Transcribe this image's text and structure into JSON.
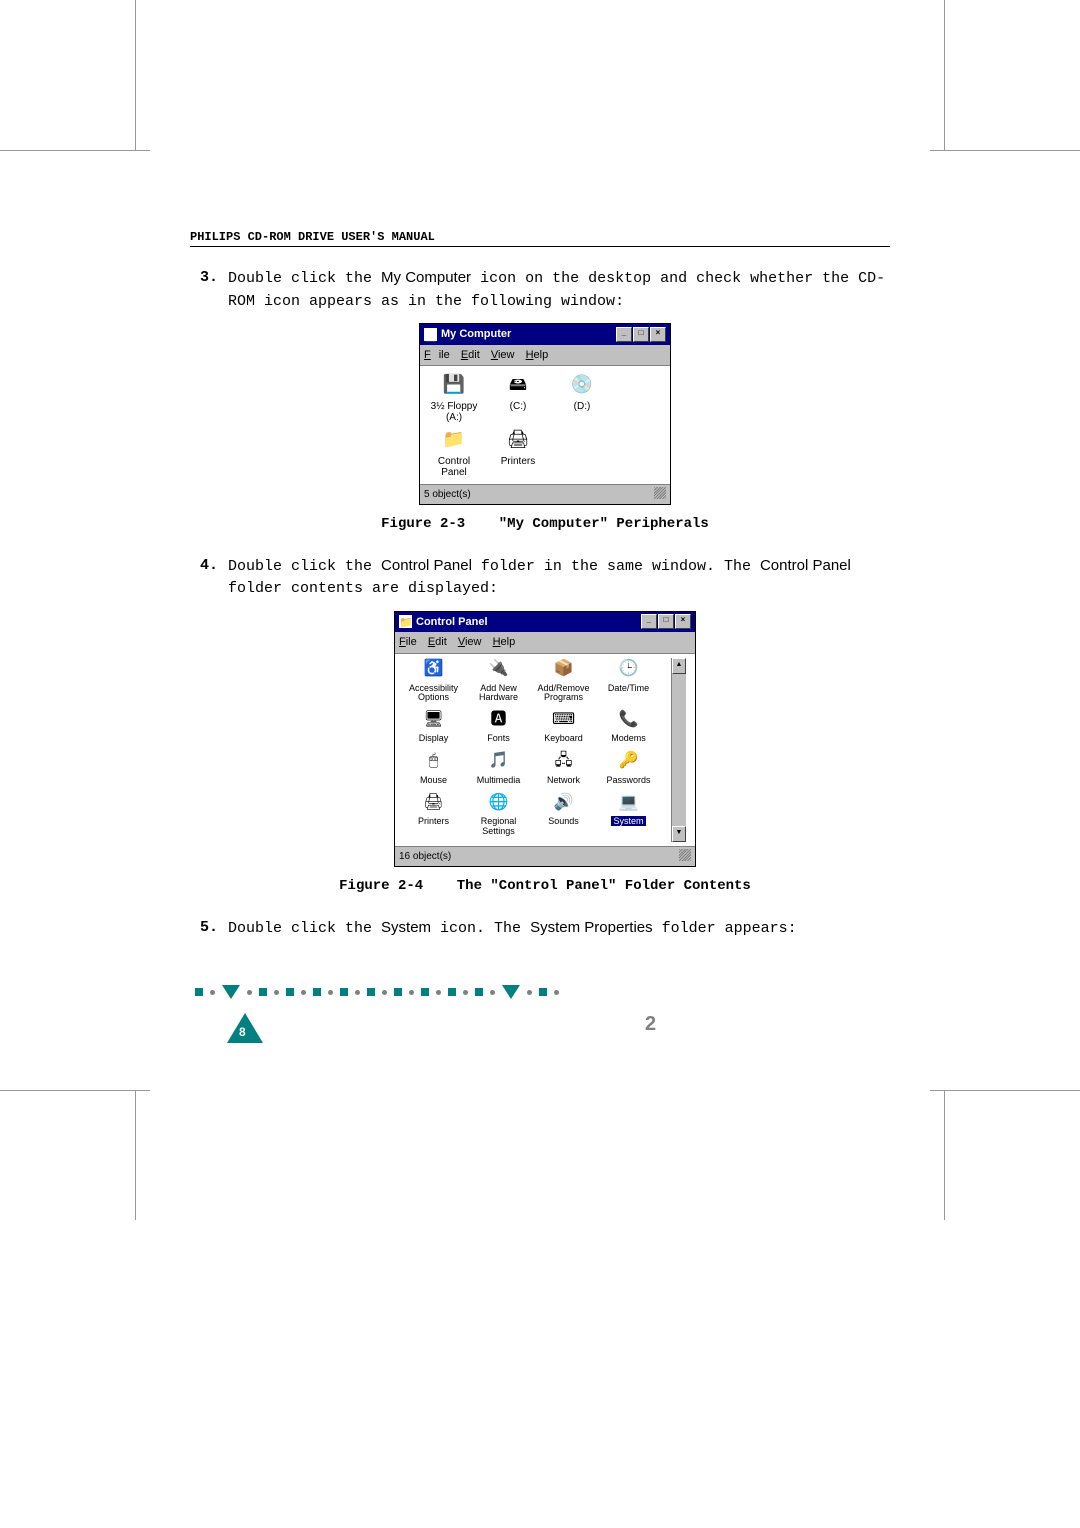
{
  "header": "PHILIPS CD-ROM DRIVE USER'S MANUAL",
  "step3": {
    "num": "3.",
    "pre": "Double click the ",
    "ui1": "My Computer",
    "mid": " icon on the desktop and check whether the CD-ROM icon appears as in the following window:"
  },
  "myComputer": {
    "title": "My Computer",
    "menus": [
      "File",
      "Edit",
      "View",
      "Help"
    ],
    "icons": [
      {
        "label": "3½ Floppy (A:)",
        "glyph": "💾"
      },
      {
        "label": "(C:)",
        "glyph": "🖴"
      },
      {
        "label": "(D:)",
        "glyph": "💿"
      },
      {
        "label": "Control Panel",
        "glyph": "📁"
      },
      {
        "label": "Printers",
        "glyph": "🖨"
      }
    ],
    "status": "5 object(s)"
  },
  "fig3": {
    "label": "Figure 2-3",
    "caption": "\"My Computer\" Peripherals"
  },
  "step4": {
    "num": "4.",
    "pre": "Double click the ",
    "ui1": "Control Panel",
    "mid": " folder in the same window.  The ",
    "ui2": "Control Panel",
    "post": " folder contents are displayed:"
  },
  "controlPanel": {
    "title": "Control Panel",
    "menus": [
      "File",
      "Edit",
      "View",
      "Help"
    ],
    "icons": [
      {
        "label": "Accessibility Options",
        "glyph": "♿"
      },
      {
        "label": "Add New Hardware",
        "glyph": "🔌"
      },
      {
        "label": "Add/Remove Programs",
        "glyph": "📦"
      },
      {
        "label": "Date/Time",
        "glyph": "🕒"
      },
      {
        "label": "Display",
        "glyph": "🖥"
      },
      {
        "label": "Fonts",
        "glyph": "🅰"
      },
      {
        "label": "Keyboard",
        "glyph": "⌨"
      },
      {
        "label": "Modems",
        "glyph": "📞"
      },
      {
        "label": "Mouse",
        "glyph": "🖱"
      },
      {
        "label": "Multimedia",
        "glyph": "🎵"
      },
      {
        "label": "Network",
        "glyph": "🖧"
      },
      {
        "label": "Passwords",
        "glyph": "🔑"
      },
      {
        "label": "Printers",
        "glyph": "🖨"
      },
      {
        "label": "Regional Settings",
        "glyph": "🌐"
      },
      {
        "label": "Sounds",
        "glyph": "🔊"
      },
      {
        "label": "System",
        "glyph": "💻",
        "selected": true
      }
    ],
    "status": "16 object(s)"
  },
  "fig4": {
    "label": "Figure 2-4",
    "caption": "The \"Control Panel\" Folder Contents"
  },
  "step5": {
    "num": "5.",
    "pre": "Double click the ",
    "ui1": "System",
    "mid": " icon.  The ",
    "ui2": "System Properties",
    "post": " folder appears:"
  },
  "footer": {
    "pageNum": "8",
    "chapterNum": "2"
  }
}
